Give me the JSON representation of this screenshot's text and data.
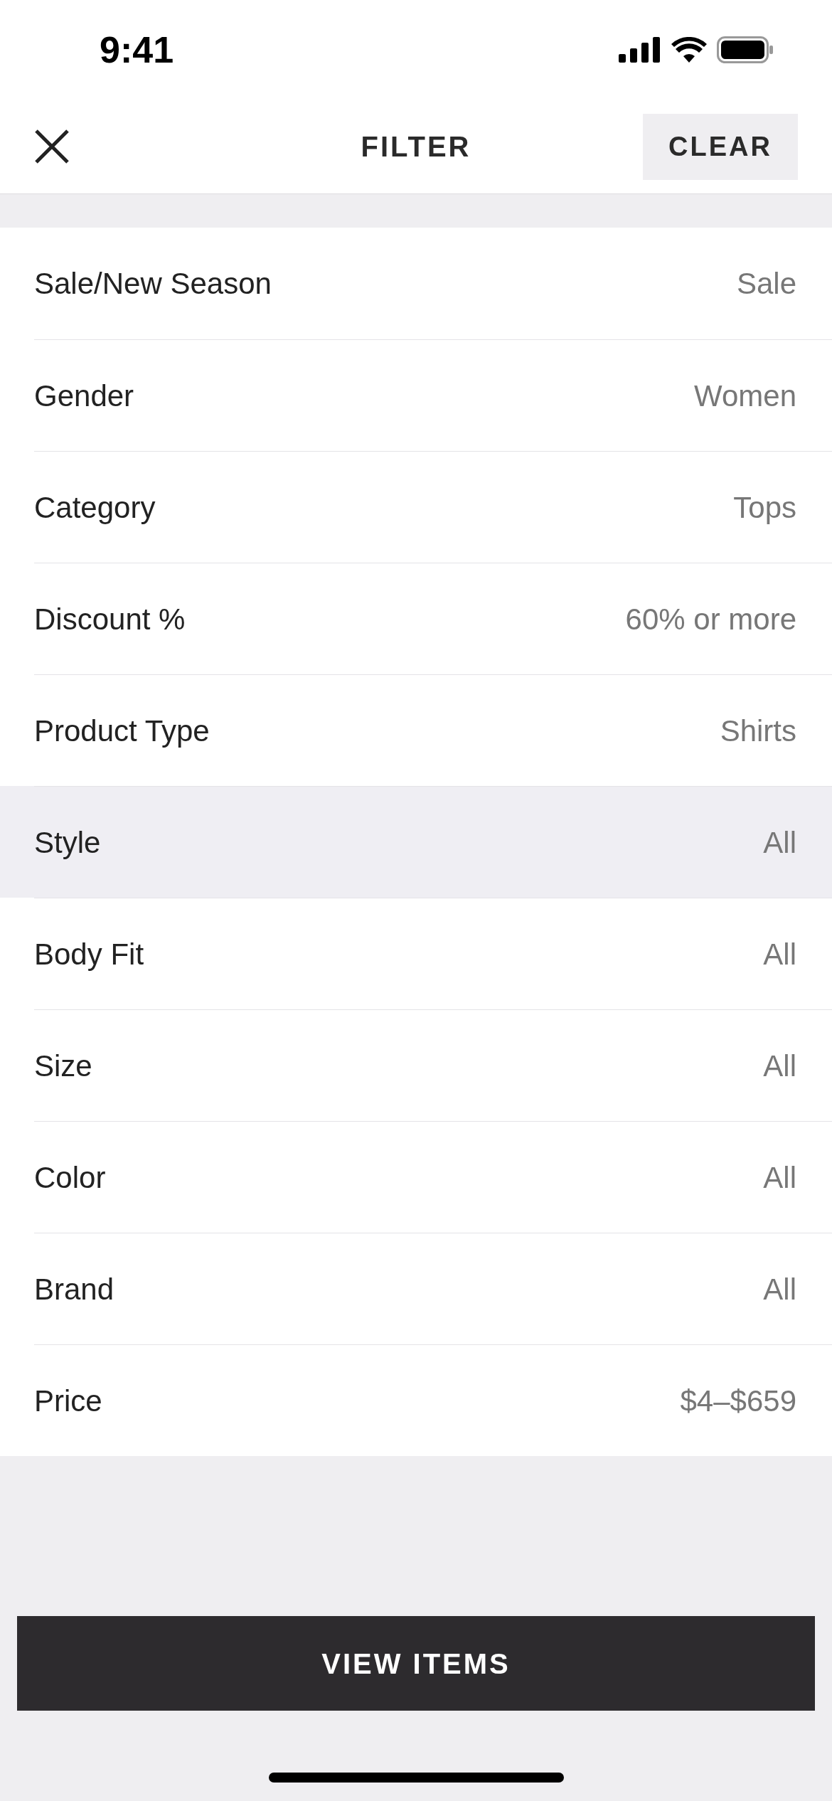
{
  "status_bar": {
    "time": "9:41"
  },
  "header": {
    "title": "FILTER",
    "clear": "CLEAR"
  },
  "filters": [
    {
      "label": "Sale/New Season",
      "value": "Sale",
      "selected": false
    },
    {
      "label": "Gender",
      "value": "Women",
      "selected": false
    },
    {
      "label": "Category",
      "value": "Tops",
      "selected": false
    },
    {
      "label": "Discount %",
      "value": "60% or more",
      "selected": false
    },
    {
      "label": "Product Type",
      "value": "Shirts",
      "selected": false
    },
    {
      "label": "Style",
      "value": "All",
      "selected": true
    },
    {
      "label": "Body Fit",
      "value": "All",
      "selected": false
    },
    {
      "label": "Size",
      "value": "All",
      "selected": false
    },
    {
      "label": "Color",
      "value": "All",
      "selected": false
    },
    {
      "label": "Brand",
      "value": "All",
      "selected": false
    },
    {
      "label": "Price",
      "value": "$4–$659",
      "selected": false
    }
  ],
  "view_button": "VIEW ITEMS"
}
